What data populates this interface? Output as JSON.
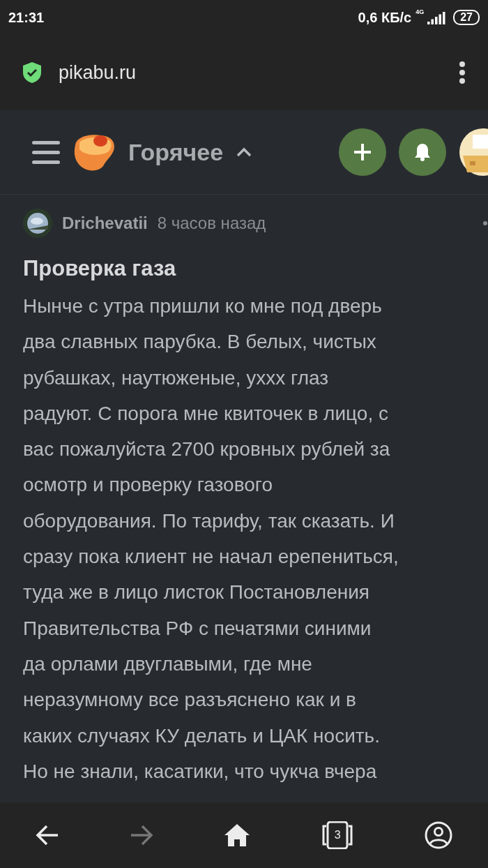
{
  "status_bar": {
    "time": "21:31",
    "speed": "0,6 КБ/с",
    "network": "4G",
    "battery": "27"
  },
  "address_bar": {
    "url": "pikabu.ru",
    "secure": true
  },
  "site_header": {
    "section": "Горячее",
    "expanded": true
  },
  "post": {
    "author": "Drichevatii",
    "time": "8 часов назад",
    "title": "Проверка газа",
    "body": "Нынче с утра пришли ко мне под дверь\nдва славных парубка. В белых, чистых\nрубашках, наутюженые, уххх глаз\nрадуют. С порога мне квиточек в лицо, с\nвас пожалуйста 2700 кровных рублей за\nосмотр и проверку газового\nоборудования. По тарифу, так сказать. И\nсразу пока клиент не начал ерепениться,\nтуда же в лицо листок Постановления\nПравительства РФ с печатями синими\nда орлами двуглавыми, где мне\nнеразумному все разъяснено как и в\nкаких случаях КУ делать и ЦАК носить.\nНо не знали, касатики, что чукча вчера"
  },
  "nav_bar": {
    "back_enabled": true,
    "forward_enabled": false,
    "tabs_count": "3"
  }
}
